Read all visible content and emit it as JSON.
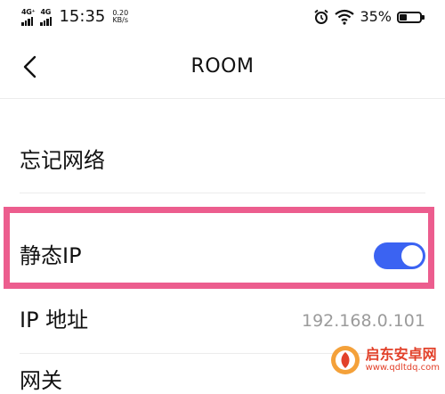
{
  "status_bar": {
    "network1": "4G⁺",
    "network2": "4G",
    "time": "15:35",
    "speed_value": "0.20",
    "speed_unit": "KB/s",
    "battery_percent": "35%",
    "battery_level": 0.35
  },
  "nav": {
    "title": "ROOM"
  },
  "rows": {
    "forget_network": "忘记网络",
    "static_ip": "静态IP",
    "static_ip_enabled": true,
    "ip_address_label": "IP 地址",
    "ip_address_value": "192.168.0.101",
    "gateway_label": "网关"
  },
  "watermark": {
    "title": "启东安卓网",
    "url": "www.qdltdq.com"
  },
  "colors": {
    "accent": "#3b63f2",
    "highlight": "#ec5d8e",
    "watermark": "#e2412a"
  }
}
